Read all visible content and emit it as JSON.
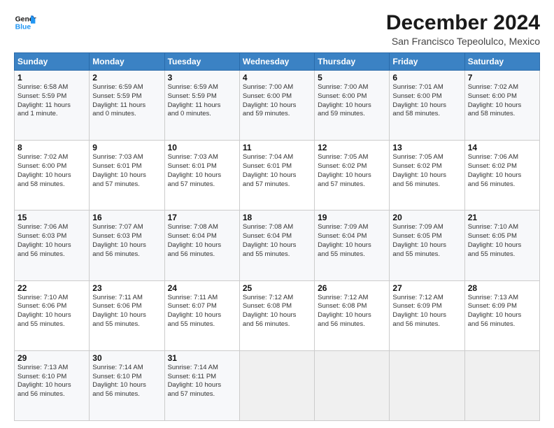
{
  "logo": {
    "line1": "General",
    "line2": "Blue"
  },
  "header": {
    "month": "December 2024",
    "location": "San Francisco Tepeolulco, Mexico"
  },
  "weekdays": [
    "Sunday",
    "Monday",
    "Tuesday",
    "Wednesday",
    "Thursday",
    "Friday",
    "Saturday"
  ],
  "weeks": [
    [
      {
        "day": "1",
        "info": "Sunrise: 6:58 AM\nSunset: 5:59 PM\nDaylight: 11 hours\nand 1 minute."
      },
      {
        "day": "2",
        "info": "Sunrise: 6:59 AM\nSunset: 5:59 PM\nDaylight: 11 hours\nand 0 minutes."
      },
      {
        "day": "3",
        "info": "Sunrise: 6:59 AM\nSunset: 5:59 PM\nDaylight: 11 hours\nand 0 minutes."
      },
      {
        "day": "4",
        "info": "Sunrise: 7:00 AM\nSunset: 6:00 PM\nDaylight: 10 hours\nand 59 minutes."
      },
      {
        "day": "5",
        "info": "Sunrise: 7:00 AM\nSunset: 6:00 PM\nDaylight: 10 hours\nand 59 minutes."
      },
      {
        "day": "6",
        "info": "Sunrise: 7:01 AM\nSunset: 6:00 PM\nDaylight: 10 hours\nand 58 minutes."
      },
      {
        "day": "7",
        "info": "Sunrise: 7:02 AM\nSunset: 6:00 PM\nDaylight: 10 hours\nand 58 minutes."
      }
    ],
    [
      {
        "day": "8",
        "info": "Sunrise: 7:02 AM\nSunset: 6:00 PM\nDaylight: 10 hours\nand 58 minutes."
      },
      {
        "day": "9",
        "info": "Sunrise: 7:03 AM\nSunset: 6:01 PM\nDaylight: 10 hours\nand 57 minutes."
      },
      {
        "day": "10",
        "info": "Sunrise: 7:03 AM\nSunset: 6:01 PM\nDaylight: 10 hours\nand 57 minutes."
      },
      {
        "day": "11",
        "info": "Sunrise: 7:04 AM\nSunset: 6:01 PM\nDaylight: 10 hours\nand 57 minutes."
      },
      {
        "day": "12",
        "info": "Sunrise: 7:05 AM\nSunset: 6:02 PM\nDaylight: 10 hours\nand 57 minutes."
      },
      {
        "day": "13",
        "info": "Sunrise: 7:05 AM\nSunset: 6:02 PM\nDaylight: 10 hours\nand 56 minutes."
      },
      {
        "day": "14",
        "info": "Sunrise: 7:06 AM\nSunset: 6:02 PM\nDaylight: 10 hours\nand 56 minutes."
      }
    ],
    [
      {
        "day": "15",
        "info": "Sunrise: 7:06 AM\nSunset: 6:03 PM\nDaylight: 10 hours\nand 56 minutes."
      },
      {
        "day": "16",
        "info": "Sunrise: 7:07 AM\nSunset: 6:03 PM\nDaylight: 10 hours\nand 56 minutes."
      },
      {
        "day": "17",
        "info": "Sunrise: 7:08 AM\nSunset: 6:04 PM\nDaylight: 10 hours\nand 56 minutes."
      },
      {
        "day": "18",
        "info": "Sunrise: 7:08 AM\nSunset: 6:04 PM\nDaylight: 10 hours\nand 55 minutes."
      },
      {
        "day": "19",
        "info": "Sunrise: 7:09 AM\nSunset: 6:04 PM\nDaylight: 10 hours\nand 55 minutes."
      },
      {
        "day": "20",
        "info": "Sunrise: 7:09 AM\nSunset: 6:05 PM\nDaylight: 10 hours\nand 55 minutes."
      },
      {
        "day": "21",
        "info": "Sunrise: 7:10 AM\nSunset: 6:05 PM\nDaylight: 10 hours\nand 55 minutes."
      }
    ],
    [
      {
        "day": "22",
        "info": "Sunrise: 7:10 AM\nSunset: 6:06 PM\nDaylight: 10 hours\nand 55 minutes."
      },
      {
        "day": "23",
        "info": "Sunrise: 7:11 AM\nSunset: 6:06 PM\nDaylight: 10 hours\nand 55 minutes."
      },
      {
        "day": "24",
        "info": "Sunrise: 7:11 AM\nSunset: 6:07 PM\nDaylight: 10 hours\nand 55 minutes."
      },
      {
        "day": "25",
        "info": "Sunrise: 7:12 AM\nSunset: 6:08 PM\nDaylight: 10 hours\nand 56 minutes."
      },
      {
        "day": "26",
        "info": "Sunrise: 7:12 AM\nSunset: 6:08 PM\nDaylight: 10 hours\nand 56 minutes."
      },
      {
        "day": "27",
        "info": "Sunrise: 7:12 AM\nSunset: 6:09 PM\nDaylight: 10 hours\nand 56 minutes."
      },
      {
        "day": "28",
        "info": "Sunrise: 7:13 AM\nSunset: 6:09 PM\nDaylight: 10 hours\nand 56 minutes."
      }
    ],
    [
      {
        "day": "29",
        "info": "Sunrise: 7:13 AM\nSunset: 6:10 PM\nDaylight: 10 hours\nand 56 minutes."
      },
      {
        "day": "30",
        "info": "Sunrise: 7:14 AM\nSunset: 6:10 PM\nDaylight: 10 hours\nand 56 minutes."
      },
      {
        "day": "31",
        "info": "Sunrise: 7:14 AM\nSunset: 6:11 PM\nDaylight: 10 hours\nand 57 minutes."
      },
      null,
      null,
      null,
      null
    ]
  ]
}
